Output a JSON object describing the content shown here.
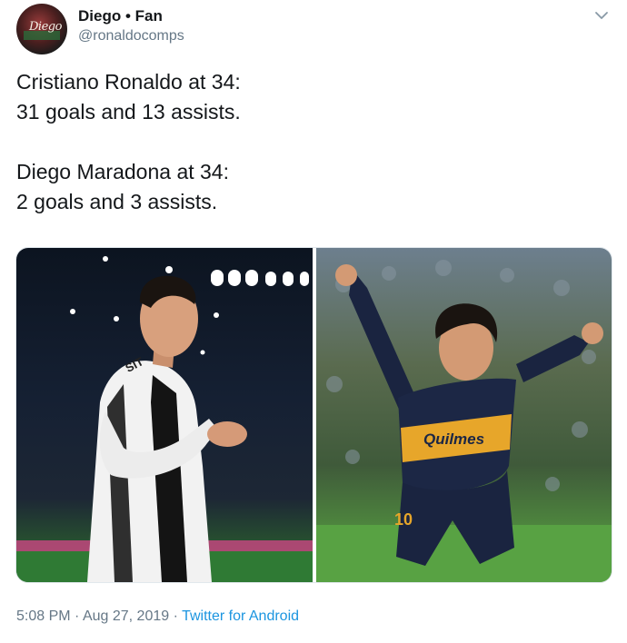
{
  "tweet": {
    "display_name": "Diego",
    "name_separator": "•",
    "name_suffix": "Fan",
    "handle": "@ronaldocomps",
    "avatar_text": "Diego",
    "text_lines": [
      "Cristiano Ronaldo at 34:",
      "31 goals and 13 assists.",
      "Diego Maradona at 34:",
      "2 goals and 3 assists."
    ],
    "media": {
      "left_jersey_text": "SIT",
      "right_shirt_sponsor": "Quilmes",
      "right_shirt_number": "10"
    },
    "time": "5:08 PM",
    "date": "Aug 27, 2019",
    "source": "Twitter for Android"
  },
  "colors": {
    "text": "#14171a",
    "muted": "#657786",
    "link": "#1b95e0"
  }
}
